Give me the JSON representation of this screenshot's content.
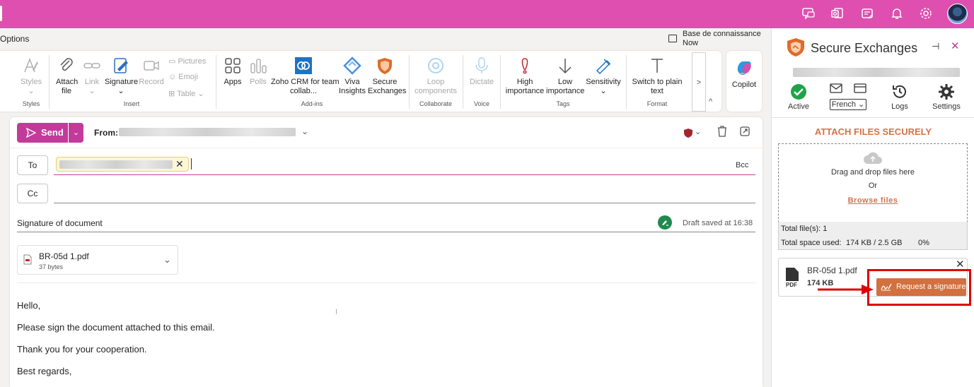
{
  "colors": {
    "accent": "#c23b9a",
    "topbar": "#df4fb0",
    "secure_accent": "#d27349",
    "highlight": "#e00000"
  },
  "topbar": {
    "icons": [
      "chat-icon",
      "outlook-icon",
      "notes-icon",
      "bell-icon",
      "gear-icon"
    ]
  },
  "options_label": "Options",
  "knowledge_base": {
    "title": "Base de connaissance",
    "subtitle": "Now"
  },
  "ribbon": {
    "styles": {
      "label": "Styles",
      "group": "Styles"
    },
    "insert": {
      "attach": "Attach file",
      "link": "Link",
      "signature": "Signature",
      "record": "Record",
      "pictures": "Pictures",
      "emoji": "Emoji",
      "table": "Table",
      "group": "Insert"
    },
    "addins": {
      "apps": "Apps",
      "polls": "Polls",
      "zoho_line1": "Zoho CRM for team",
      "zoho_line2": "collab...",
      "viva_line1": "Viva",
      "viva_line2": "Insights",
      "secure_line1": "Secure",
      "secure_line2": "Exchanges",
      "group": "Add-ins"
    },
    "collaborate": {
      "loop_line1": "Loop",
      "loop_line2": "components",
      "group": "Collaborate"
    },
    "voice": {
      "dictate": "Dictate",
      "group": "Voice"
    },
    "tags": {
      "high_line1": "High",
      "high_line2": "importance",
      "low_line1": "Low",
      "low_line2": "importance",
      "sensitivity": "Sensitivity",
      "group": "Tags"
    },
    "format": {
      "switch_line1": "Switch to plain",
      "switch_line2": "text",
      "group": "Format"
    },
    "more": ">",
    "collapse": "^",
    "copilot": "Copilot"
  },
  "compose": {
    "send": "Send",
    "from_label": "From:",
    "to_label": "To",
    "cc_label": "Cc",
    "bcc_label": "Bcc",
    "subject": "Signature of document",
    "draft_status": "Draft saved at 16:38",
    "attachment": {
      "name": "BR-05d 1.pdf",
      "size": "37 bytes"
    },
    "body": [
      "Hello,",
      "Please sign the document attached to this email.",
      "Thank you for your cooperation.",
      "Best regards,"
    ]
  },
  "panel": {
    "title": "Secure Exchanges",
    "status": "Active",
    "language": "French",
    "logs": "Logs",
    "settings": "Settings",
    "attach_title": "ATTACH FILES SECURELY",
    "drop_text": "Drag and drop files here",
    "or_text": "Or",
    "browse": "Browse files",
    "total_files": "Total file(s): 1",
    "total_space_label": "Total space used:",
    "total_space_value": "174 KB / 2.5 GB",
    "total_space_pct": "0%",
    "file": {
      "name": "BR-05d 1.pdf",
      "type": "PDF",
      "size": "174 KB"
    },
    "request_signature": "Request a signature"
  }
}
